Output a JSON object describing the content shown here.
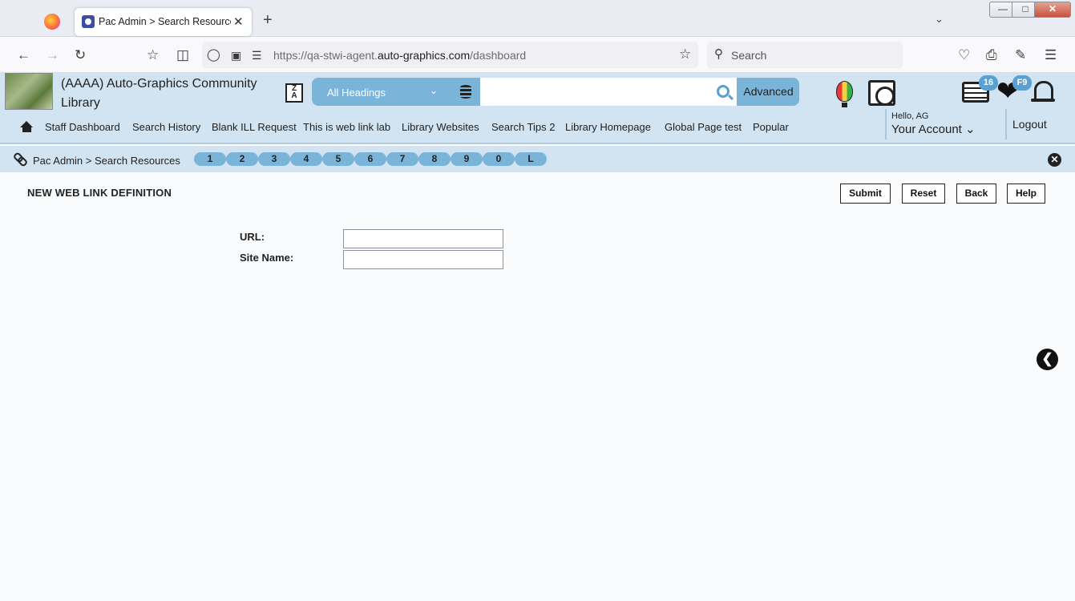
{
  "browser": {
    "tab_title": "Pac Admin > Search Resources",
    "tab_close": "✕",
    "new_tab": "+",
    "url_prefix": "https://qa-stwi-agent.",
    "url_host": "auto-graphics.com",
    "url_path": "/dashboard",
    "search_placeholder": "Search"
  },
  "app": {
    "library_name": "(AAAA) Auto-Graphics Community Library",
    "search": {
      "heading_option": "All Headings",
      "query": "",
      "advanced_label": "Advanced"
    },
    "badges": {
      "lists_count": "16",
      "favorites_label": "F9"
    },
    "menu": [
      "Staff Dashboard",
      "Search History",
      "Blank ILL Request",
      "This is web link lab",
      "Library Websites",
      "Search Tips 2",
      "Library Homepage",
      "Global Page test",
      "Popular"
    ],
    "account": {
      "greeting": "Hello, AG",
      "label": "Your Account"
    },
    "logout_label": "Logout"
  },
  "breadcrumb": {
    "text": "Pac Admin > Search Resources",
    "tabs": [
      "1",
      "2",
      "3",
      "4",
      "5",
      "6",
      "7",
      "8",
      "9",
      "0",
      "L"
    ]
  },
  "form": {
    "title": "NEW WEB LINK DEFINITION",
    "buttons": {
      "submit": "Submit",
      "reset": "Reset",
      "back": "Back",
      "help": "Help"
    },
    "fields": {
      "url_label": "URL:",
      "url_value": "",
      "site_name_label": "Site Name:",
      "site_name_value": ""
    }
  }
}
